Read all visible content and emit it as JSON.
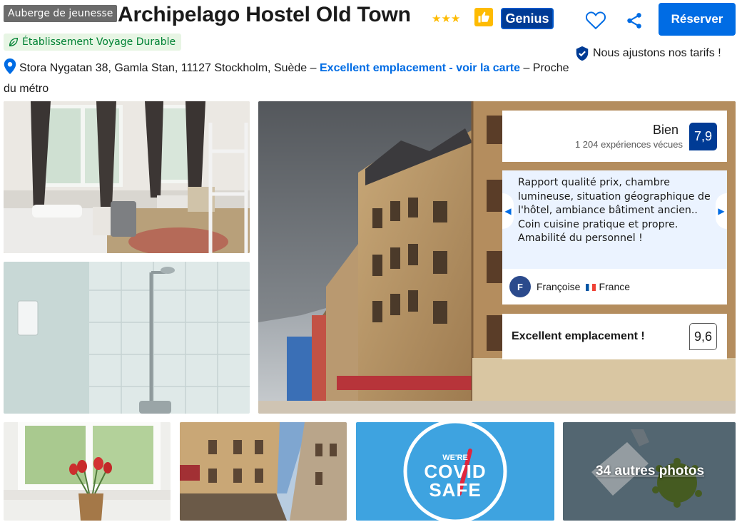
{
  "header": {
    "type_badge": "Auberge de jeunesse",
    "title": "Archipelago Hostel Old Town",
    "stars": "★★★",
    "genius_label": "Genius",
    "reserve_label": "Réserver",
    "eco_label": "Établissement Voyage Durable",
    "price_match": "Nous ajustons nos tarifs !",
    "address": "Stora Nygatan 38, Gamla Stan, 11127 Stockholm, Suède",
    "address_sep": " – ",
    "map_link": "Excellent emplacement - voir la carte",
    "address_tail": " – Proche du métro"
  },
  "score": {
    "word": "Bien",
    "count": "1 204 expériences vécues",
    "value": "7,9"
  },
  "review": {
    "text": "Rapport qualité prix, chambre lumineuse, situation géographique de l'hôtel, ambiance bâtiment ancien.. Coin cuisine pratique et propre. Amabilité du personnel !",
    "avatar_letter": "F",
    "author": "Françoise",
    "country": "France"
  },
  "location": {
    "label": "Excellent emplacement !",
    "score": "9,6"
  },
  "gallery": {
    "covid_line1": "WE'RE",
    "covid_line2": "COVID",
    "covid_line3": "SAFE",
    "more_label": "34 autres photos"
  },
  "colors": {
    "brand_blue": "#003b95",
    "action_blue": "#006ce4",
    "star_yellow": "#febb02",
    "eco_green": "#008234",
    "review_bg": "#ebf3ff"
  },
  "icons": [
    "thumbs-up-icon",
    "heart-icon",
    "share-icon",
    "leaf-icon",
    "shield-check-icon",
    "location-pin-icon",
    "chevron-left-icon",
    "chevron-right-icon"
  ]
}
